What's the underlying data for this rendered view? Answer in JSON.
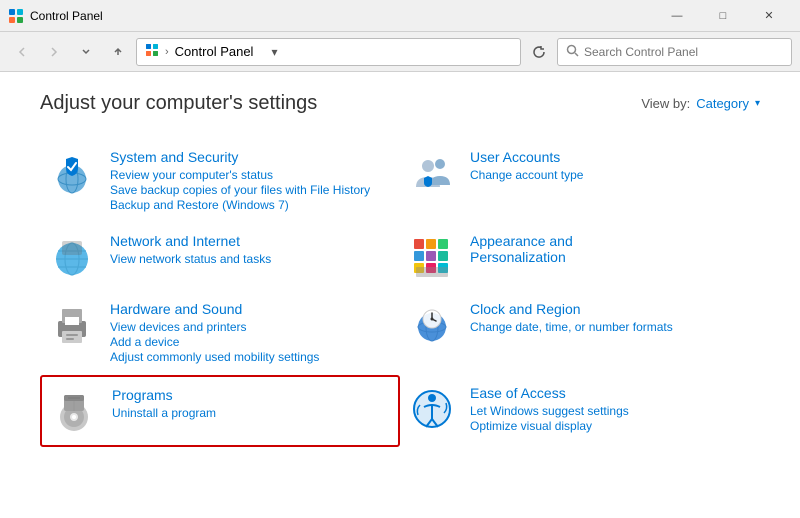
{
  "titleBar": {
    "title": "Control Panel",
    "minimizeLabel": "—",
    "maximizeLabel": "□",
    "closeLabel": "✕"
  },
  "addressBar": {
    "backLabel": "←",
    "forwardLabel": "→",
    "upLabel": "↑",
    "addressIcon": "📁",
    "breadcrumb": "Control Panel",
    "dropdownLabel": "▾",
    "refreshLabel": "↺",
    "searchPlaceholder": "Search Control Panel"
  },
  "mainContent": {
    "pageTitle": "Adjust your computer's settings",
    "viewByLabel": "View by:",
    "viewByValue": "Category",
    "viewByArrow": "▾"
  },
  "categories": [
    {
      "id": "system-security",
      "name": "System and Security",
      "links": [
        "Review your computer's status",
        "Save backup copies of your files with File History",
        "Backup and Restore (Windows 7)"
      ],
      "highlighted": false
    },
    {
      "id": "user-accounts",
      "name": "User Accounts",
      "links": [
        "Change account type"
      ],
      "highlighted": false
    },
    {
      "id": "network-internet",
      "name": "Network and Internet",
      "links": [
        "View network status and tasks"
      ],
      "highlighted": false
    },
    {
      "id": "appearance-personalization",
      "name": "Appearance and Personalization",
      "links": [],
      "highlighted": false
    },
    {
      "id": "hardware-sound",
      "name": "Hardware and Sound",
      "links": [
        "View devices and printers",
        "Add a device",
        "Adjust commonly used mobility settings"
      ],
      "highlighted": false
    },
    {
      "id": "clock-region",
      "name": "Clock and Region",
      "links": [
        "Change date, time, or number formats"
      ],
      "highlighted": false
    },
    {
      "id": "programs",
      "name": "Programs",
      "links": [
        "Uninstall a program"
      ],
      "highlighted": true
    },
    {
      "id": "ease-of-access",
      "name": "Ease of Access",
      "links": [
        "Let Windows suggest settings",
        "Optimize visual display"
      ],
      "highlighted": false
    }
  ]
}
